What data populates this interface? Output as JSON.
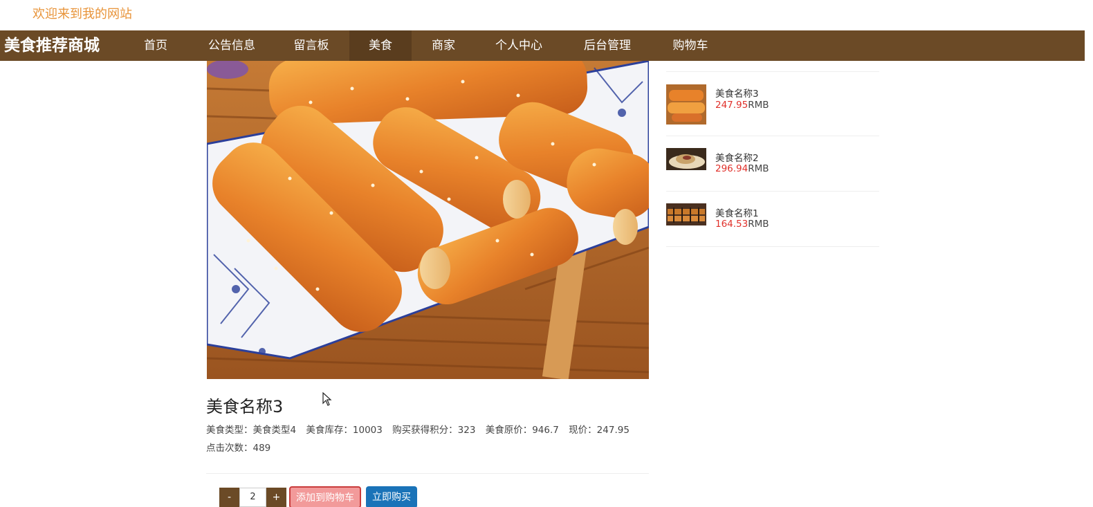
{
  "header": {
    "welcome": "欢迎来到我的网站"
  },
  "nav": {
    "brand": "美食推荐商城",
    "items": [
      {
        "label": "首页"
      },
      {
        "label": "公告信息"
      },
      {
        "label": "留言板"
      },
      {
        "label": "美食"
      },
      {
        "label": "商家"
      },
      {
        "label": "个人中心"
      },
      {
        "label": "后台管理"
      },
      {
        "label": "购物车"
      }
    ],
    "active_index": 3
  },
  "product": {
    "title": "美食名称3",
    "type_label": "美食类型：",
    "type_value": "美食类型4",
    "stock_label": "美食库存：",
    "stock_value": "10003",
    "points_label": "购买获得积分：",
    "points_value": "323",
    "orig_price_label": "美食原价：",
    "orig_price_value": "946.7",
    "price_label": "现价：",
    "price_value": "247.95",
    "clicks_label": "点击次数：",
    "clicks_value": "489"
  },
  "purchase": {
    "minus": "-",
    "quantity": "2",
    "plus": "+",
    "add_to_cart": "添加到购物车",
    "buy_now": "立即购买"
  },
  "sidebar": {
    "items": [
      {
        "name": "美食名称3",
        "price": "247.95",
        "unit": "RMB"
      },
      {
        "name": "美食名称2",
        "price": "296.94",
        "unit": "RMB"
      },
      {
        "name": "美食名称1",
        "price": "164.53",
        "unit": "RMB"
      }
    ]
  },
  "colors": {
    "nav_bg": "#6b4a26",
    "welcome": "#e8943a",
    "price_red": "#e0302a",
    "cart_btn": "#f29a9a",
    "buy_btn": "#1a73b8"
  }
}
